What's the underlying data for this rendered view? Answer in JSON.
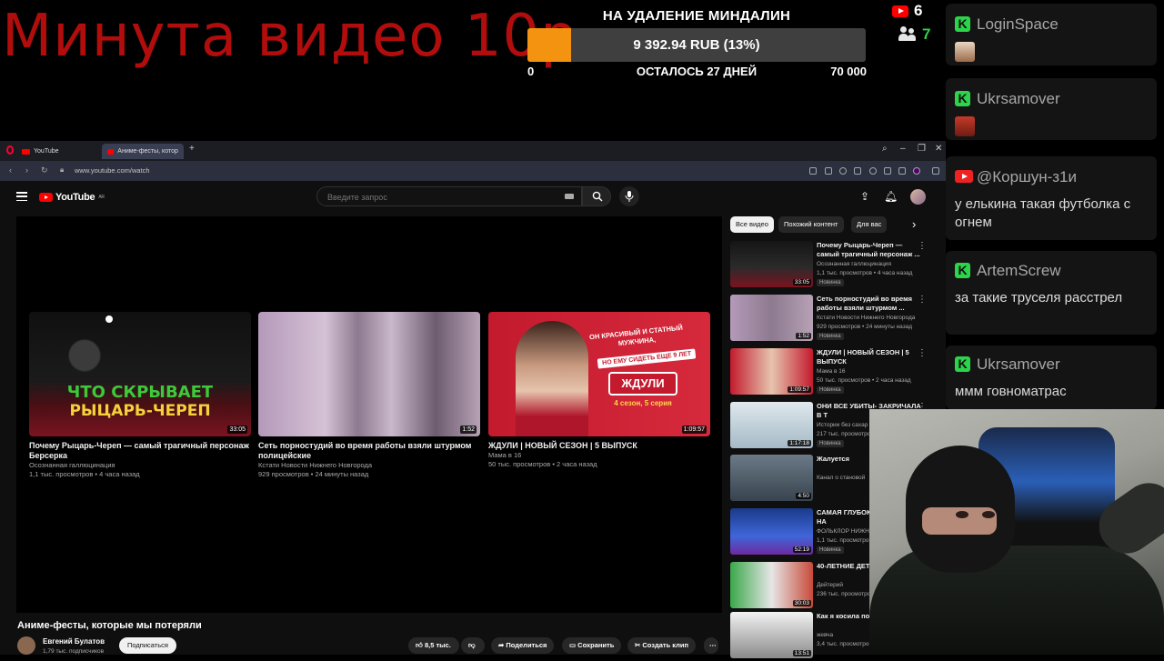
{
  "overlay": {
    "promo_text": "Минута видео 10р",
    "goal": {
      "title": "НА УДАЛЕНИЕ МИНДАЛИН",
      "value_text": "9 392.94 RUB (13%)",
      "progress_fraction": 0.13,
      "min": "0",
      "remaining": "ОСТАЛОСЬ 27 ДНЕЙ",
      "max": "70 000"
    },
    "stats": {
      "youtube_count": "6",
      "viewers_count": "7"
    },
    "colors": {
      "promo": "#b20d0d",
      "goal_fill": "#f4930f",
      "kick": "#2bd44a",
      "viewers": "#2bd44a"
    }
  },
  "chat": {
    "messages": [
      {
        "platform": "kick",
        "user": "LoginSpace",
        "text": ""
      },
      {
        "platform": "kick",
        "user": "Ukrsamover",
        "text": ""
      },
      {
        "platform": "youtube",
        "user": "@Коршун-з1и",
        "text": "у елькина такая футболка с огнем"
      },
      {
        "platform": "kick",
        "user": "ArtemScrew",
        "text": "за такие труселя расстрел"
      },
      {
        "platform": "kick",
        "user": "Ukrsamover",
        "text": "ммм говноматрас"
      }
    ]
  },
  "browser": {
    "tabs": [
      {
        "label": "YouTube"
      },
      {
        "label": "Аниме-фесты, которые м"
      }
    ],
    "new_tab_icon": "plus-icon",
    "url": "www.youtube.com/watch"
  },
  "youtube": {
    "logo_text": "YouTube",
    "logo_region": "AR",
    "search_placeholder": "Введите запрос",
    "video_title": "Аниме-фесты, которые мы потеряли",
    "channel": {
      "name": "Евгений Булатов",
      "subs": "1,79 тыс. подписчиков"
    },
    "subscribe_label": "Подписаться",
    "actions": {
      "likes": "8,5 тыс.",
      "share": "Поделиться",
      "save": "Сохранить",
      "clip": "Создать клип"
    },
    "endcards": [
      {
        "title": "Почему Рыцарь-Череп — самый трагичный персонаж Берсерка",
        "channel": "Осознанная галлюцинация",
        "meta": "1,1 тыс. просмотров • 4 часа назад",
        "duration": "33:05",
        "thumb_text_1": "ЧТО СКРЫВАЕТ",
        "thumb_text_2": "РЫЦАРЬ-ЧЕРЕП"
      },
      {
        "title": "Сеть порностудий во время работы взяли штурмом полицейские",
        "channel": "Кстати Новости Нижнего Новгорода",
        "meta": "929 просмотров • 24 минуты назад",
        "duration": "1:52",
        "thumb_text_1": "",
        "thumb_text_2": ""
      },
      {
        "title": "ЖДУЛИ | НОВЫЙ СЕЗОН | 5 ВЫПУСК",
        "channel": "",
        "meta": "50 тыс. просмотров • 2 часа назад",
        "channel_line": "Мама в 16",
        "duration": "1:09:57",
        "thumb_text_1": "ОН КРАСИВЫЙ И СТАТНЫЙ МУЖЧИНА,",
        "thumb_text_2": "НО ЕМУ СИДЕТЬ ЕЩЕ 9 ЛЕТ",
        "thumb_text_3": "ЖДУЛИ",
        "thumb_text_4": "4 сезон, 5 серия"
      }
    ],
    "chips": [
      "Все видео",
      "Похожий контент",
      "Для вас"
    ],
    "recommendations": [
      {
        "title": "Почему Рыцарь-Череп — самый трагичный персонаж ...",
        "channel": "Осознанная галлюцинация",
        "meta": "1,1 тыс. просмотров • 4 часа назад",
        "badge": "Новинка",
        "duration": "33:05"
      },
      {
        "title": "Сеть порностудий во время работы взяли штурмом ...",
        "channel": "Кстати Новости Нижнего Новгорода",
        "meta": "929 просмотров • 24 минуты назад",
        "badge": "Новинка",
        "duration": "1:52"
      },
      {
        "title": "ЖДУЛИ | НОВЫЙ СЕЗОН | 5 ВЫПУСК",
        "channel": "Мама в 16",
        "meta": "50 тыс. просмотров • 2 часа назад",
        "badge": "Новинка",
        "duration": "1:09:57"
      },
      {
        "title": "ОНИ ВСЕ УБИТЫ- ЗАКРИЧАЛА В Т",
        "channel": "Истории без сахар",
        "meta": "217 тыс. просмотров",
        "badge": "Новинка",
        "duration": "1:17:18"
      },
      {
        "title": "Жалуется",
        "channel": "Канал о становой",
        "meta": "",
        "badge": "",
        "duration": "4:50"
      },
      {
        "title": "САМАЯ ГЛУБОК АНАЛИТИКА НА",
        "channel": "ФОЛЬКЛОР НИЖН",
        "meta": "1,1 тыс. просмотров",
        "badge": "Новинка",
        "duration": "52:19"
      },
      {
        "title": "40-ЛЕТНИЕ ДЕТ",
        "channel": "Дейтерий",
        "meta": "236 тыс. просмотров",
        "badge": "",
        "duration": "30:03"
      },
      {
        "title": "Как я косила по году",
        "channel": "жевча",
        "meta": "3,4 тыс. просмотров",
        "badge": "",
        "duration": "13:51"
      }
    ]
  }
}
